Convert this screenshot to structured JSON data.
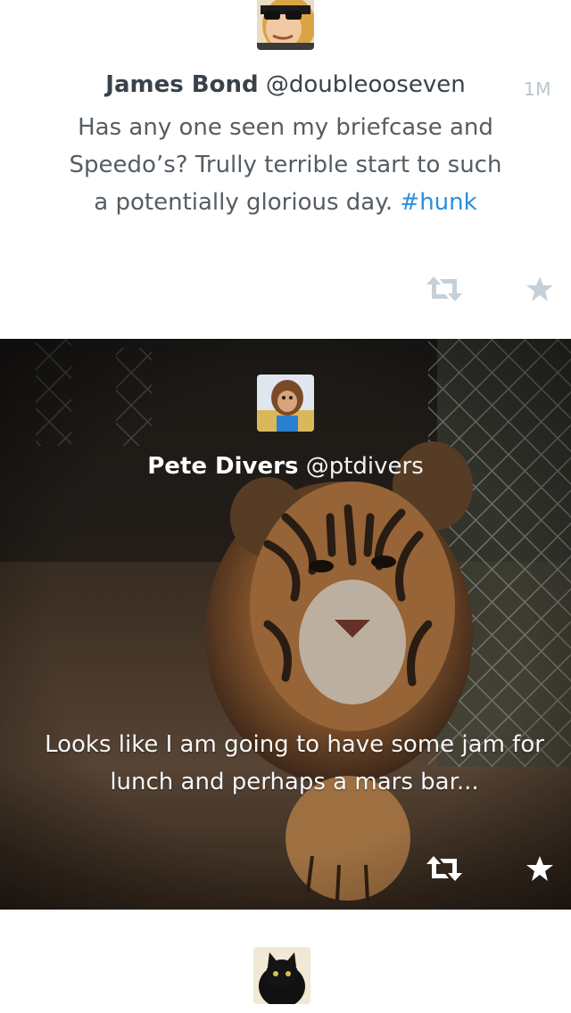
{
  "tweets": [
    {
      "author_name": "James Bond",
      "handle": "@doubleooseven",
      "time": "1M",
      "text_before_hashtag": "Has any one seen my briefcase and Speedo’s? Trully terrible start to such a potentially glorious day. ",
      "hashtag": "#hunk",
      "icons": {
        "avatar": "avatar-sunglasses",
        "retweet": "retweet-icon",
        "favorite": "star-icon"
      },
      "colors": {
        "name": "#39424a",
        "text": "#555d64",
        "hashtag": "#2a8fdc",
        "icon": "#c5d0d8"
      }
    },
    {
      "author_name": "Pete Divers",
      "handle": "@ptdivers",
      "text": "Looks like I am going to have some jam for lunch and perhaps a mars bar...",
      "icons": {
        "avatar": "avatar-monkey-mask",
        "retweet": "retweet-icon",
        "favorite": "star-icon",
        "background": "tiger-photo"
      },
      "colors": {
        "text": "#ffffff",
        "icon": "#ffffff"
      }
    },
    {
      "icons": {
        "avatar": "avatar-black-cat"
      }
    }
  ]
}
